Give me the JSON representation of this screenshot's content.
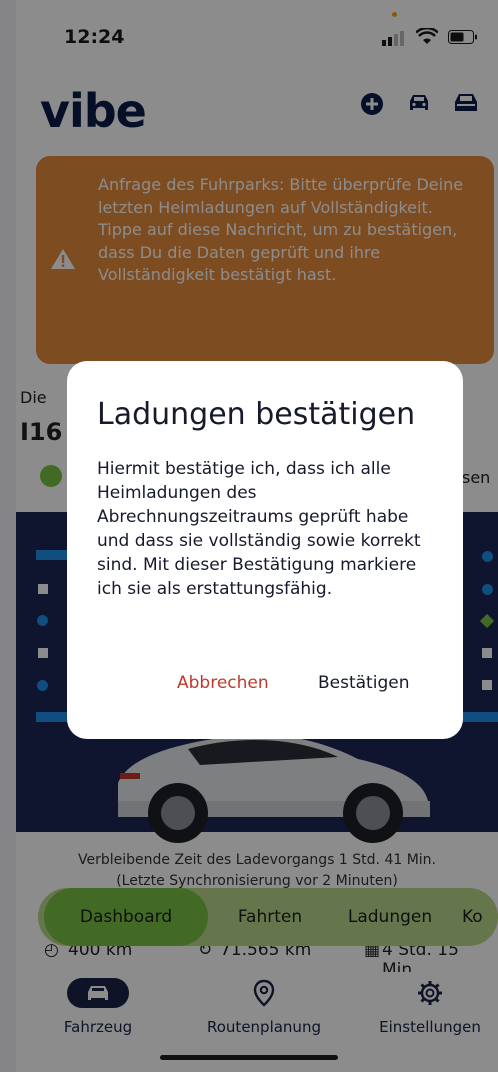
{
  "status_bar": {
    "time": "12:24"
  },
  "header": {
    "logo": "vibe",
    "icons": [
      "plus-circle-icon",
      "car-icon",
      "car-front-icon"
    ]
  },
  "banner": {
    "text": "Anfrage des Fuhrparks: Bitte überprüfe Deine letzten Heimladungen auf Vollständigkeit. Tippe auf diese Nachricht, um zu bestätigen, dass Du die Daten geprüft und ihre Vollständigkeit bestätigt hast.",
    "icon": "warning-icon"
  },
  "background": {
    "partial_left_1": "Die",
    "partial_left_2": "I16",
    "partial_right": "sen"
  },
  "charge": {
    "remaining": "Verbleibende Zeit des Ladevorgangs 1 Std. 41 Min.",
    "sync": "(Letzte Synchronisierung vor 2 Minuten)"
  },
  "stats": {
    "range": "400 km",
    "odometer": "71.565 km",
    "duration": "4 Std. 15 Min."
  },
  "tabs": [
    {
      "label": "Dashboard",
      "active": true
    },
    {
      "label": "Fahrten",
      "active": false
    },
    {
      "label": "Ladungen",
      "active": false
    },
    {
      "label": "Ko",
      "active": false
    }
  ],
  "bottom_nav": [
    {
      "label": "Fahrzeug",
      "icon": "car-icon",
      "active": true
    },
    {
      "label": "Routenplanung",
      "icon": "map-pin-icon",
      "active": false
    },
    {
      "label": "Einstellungen",
      "icon": "gear-icon",
      "active": false
    }
  ],
  "dialog": {
    "title": "Ladungen bestätigen",
    "body": "Hiermit bestätige ich, dass ich alle Heimladungen des Abrechnungszeitraums geprüft habe und dass sie vollständig sowie korrekt sind. Mit dieser Bestätigung markiere ich sie als erstattungsfähig.",
    "cancel_label": "Abbrechen",
    "confirm_label": "Bestätigen"
  },
  "colors": {
    "accent_green": "#7bc142",
    "banner_orange": "#e58a3c",
    "navy": "#1d2556",
    "cancel_red": "#c0392b"
  }
}
